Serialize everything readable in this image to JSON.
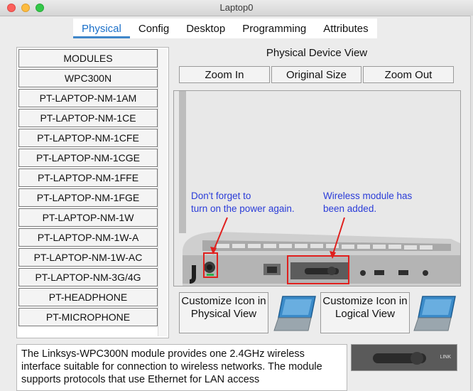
{
  "window": {
    "title": "Laptop0"
  },
  "tabs": [
    {
      "label": "Physical",
      "active": true
    },
    {
      "label": "Config"
    },
    {
      "label": "Desktop"
    },
    {
      "label": "Programming"
    },
    {
      "label": "Attributes"
    }
  ],
  "modules": [
    "MODULES",
    "WPC300N",
    "PT-LAPTOP-NM-1AM",
    "PT-LAPTOP-NM-1CE",
    "PT-LAPTOP-NM-1CFE",
    "PT-LAPTOP-NM-1CGE",
    "PT-LAPTOP-NM-1FFE",
    "PT-LAPTOP-NM-1FGE",
    "PT-LAPTOP-NM-1W",
    "PT-LAPTOP-NM-1W-A",
    "PT-LAPTOP-NM-1W-AC",
    "PT-LAPTOP-NM-3G/4G",
    "PT-HEADPHONE",
    "PT-MICROPHONE"
  ],
  "physical_view": {
    "title": "Physical Device View",
    "zoom_in": "Zoom In",
    "original_size": "Original Size",
    "zoom_out": "Zoom Out"
  },
  "annotations": {
    "power_line1": "Don't forget to",
    "power_line2": "turn on the power again.",
    "module_line1": "Wireless module has",
    "module_line2": "been added."
  },
  "customize": {
    "physical": "Customize Icon in Physical View",
    "logical": "Customize Icon in Logical View"
  },
  "description": "The Linksys-WPC300N module provides one 2.4GHz wireless interface suitable for connection to wireless networks. The module supports protocols that use Ethernet for LAN access",
  "thumbnail_label": "LINK",
  "colors": {
    "accent": "#1a6fc9",
    "annotation": "#2a3cd8",
    "highlight": "#e0201e",
    "laptop_icon": "#3b8bc9"
  }
}
